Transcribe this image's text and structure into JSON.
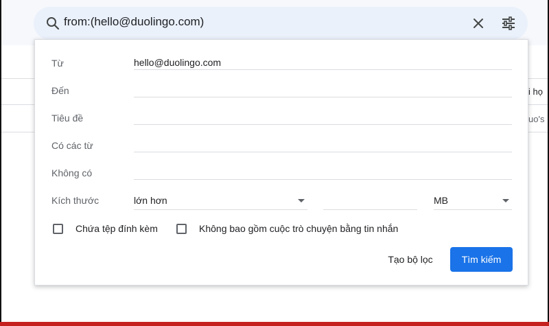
{
  "search": {
    "query": "from:(hello@duolingo.com)"
  },
  "background": {
    "text_1": "i họ",
    "text_2": "uo's"
  },
  "form": {
    "from_label": "Từ",
    "from_value": "hello@duolingo.com",
    "to_label": "Đến",
    "subject_label": "Tiêu đề",
    "has_words_label": "Có các từ",
    "doesnt_have_label": "Không có",
    "size_label": "Kích thước",
    "size_operator": "lớn hơn",
    "size_unit": "MB",
    "has_attachment_label": "Chứa tệp đính kèm",
    "exclude_chats_label": "Không bao gồm cuộc trò chuyện bằng tin nhắn",
    "create_filter_label": "Tạo bộ lọc",
    "search_button_label": "Tìm kiếm"
  },
  "colors": {
    "accent": "#1a73e8",
    "searchbar_bg": "#eaf1fb"
  }
}
